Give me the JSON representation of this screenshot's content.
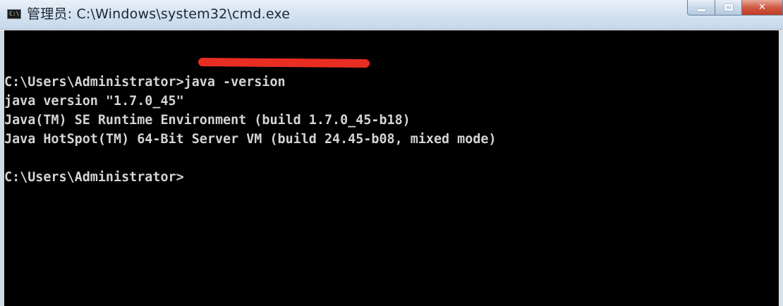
{
  "window": {
    "title": "管理员: C:\\Windows\\system32\\cmd.exe",
    "icon": "cmd-app-icon"
  },
  "caption_buttons": {
    "minimize_icon": "minimize-icon",
    "maximize_icon": "maximize-icon",
    "close_icon": "close-icon"
  },
  "console": {
    "lines": [
      "C:\\Users\\Administrator>java -version",
      "java version \"1.7.0_45\"",
      "Java(TM) SE Runtime Environment (build 1.7.0_45-b18)",
      "Java HotSpot(TM) 64-Bit Server VM (build 24.45-b08, mixed mode)",
      "",
      "C:\\Users\\Administrator>"
    ]
  },
  "colors": {
    "console_background": "#000000",
    "console_text": "#d4d4d4",
    "annotation": "#ea2d22",
    "close_button": "#c13a22"
  }
}
